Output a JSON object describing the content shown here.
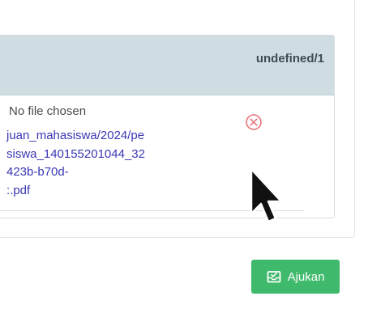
{
  "panel": {
    "progress": "undefined/1",
    "file_input_status": "No file chosen",
    "file_link": {
      "lines": [
        "juan_mahasiswa/2024/pe",
        "siswa_140155201044_32",
        "423b-b70d-",
        ":.pdf"
      ]
    },
    "remove_icon": "circle-x-icon"
  },
  "submit": {
    "label": "Ajukan",
    "icon": "inbox-tray-icon"
  },
  "colors": {
    "header_bg": "#cfdde3",
    "link": "#3a37b5",
    "remove_icon": "#e8747c",
    "submit_bg": "#3fb96c"
  }
}
